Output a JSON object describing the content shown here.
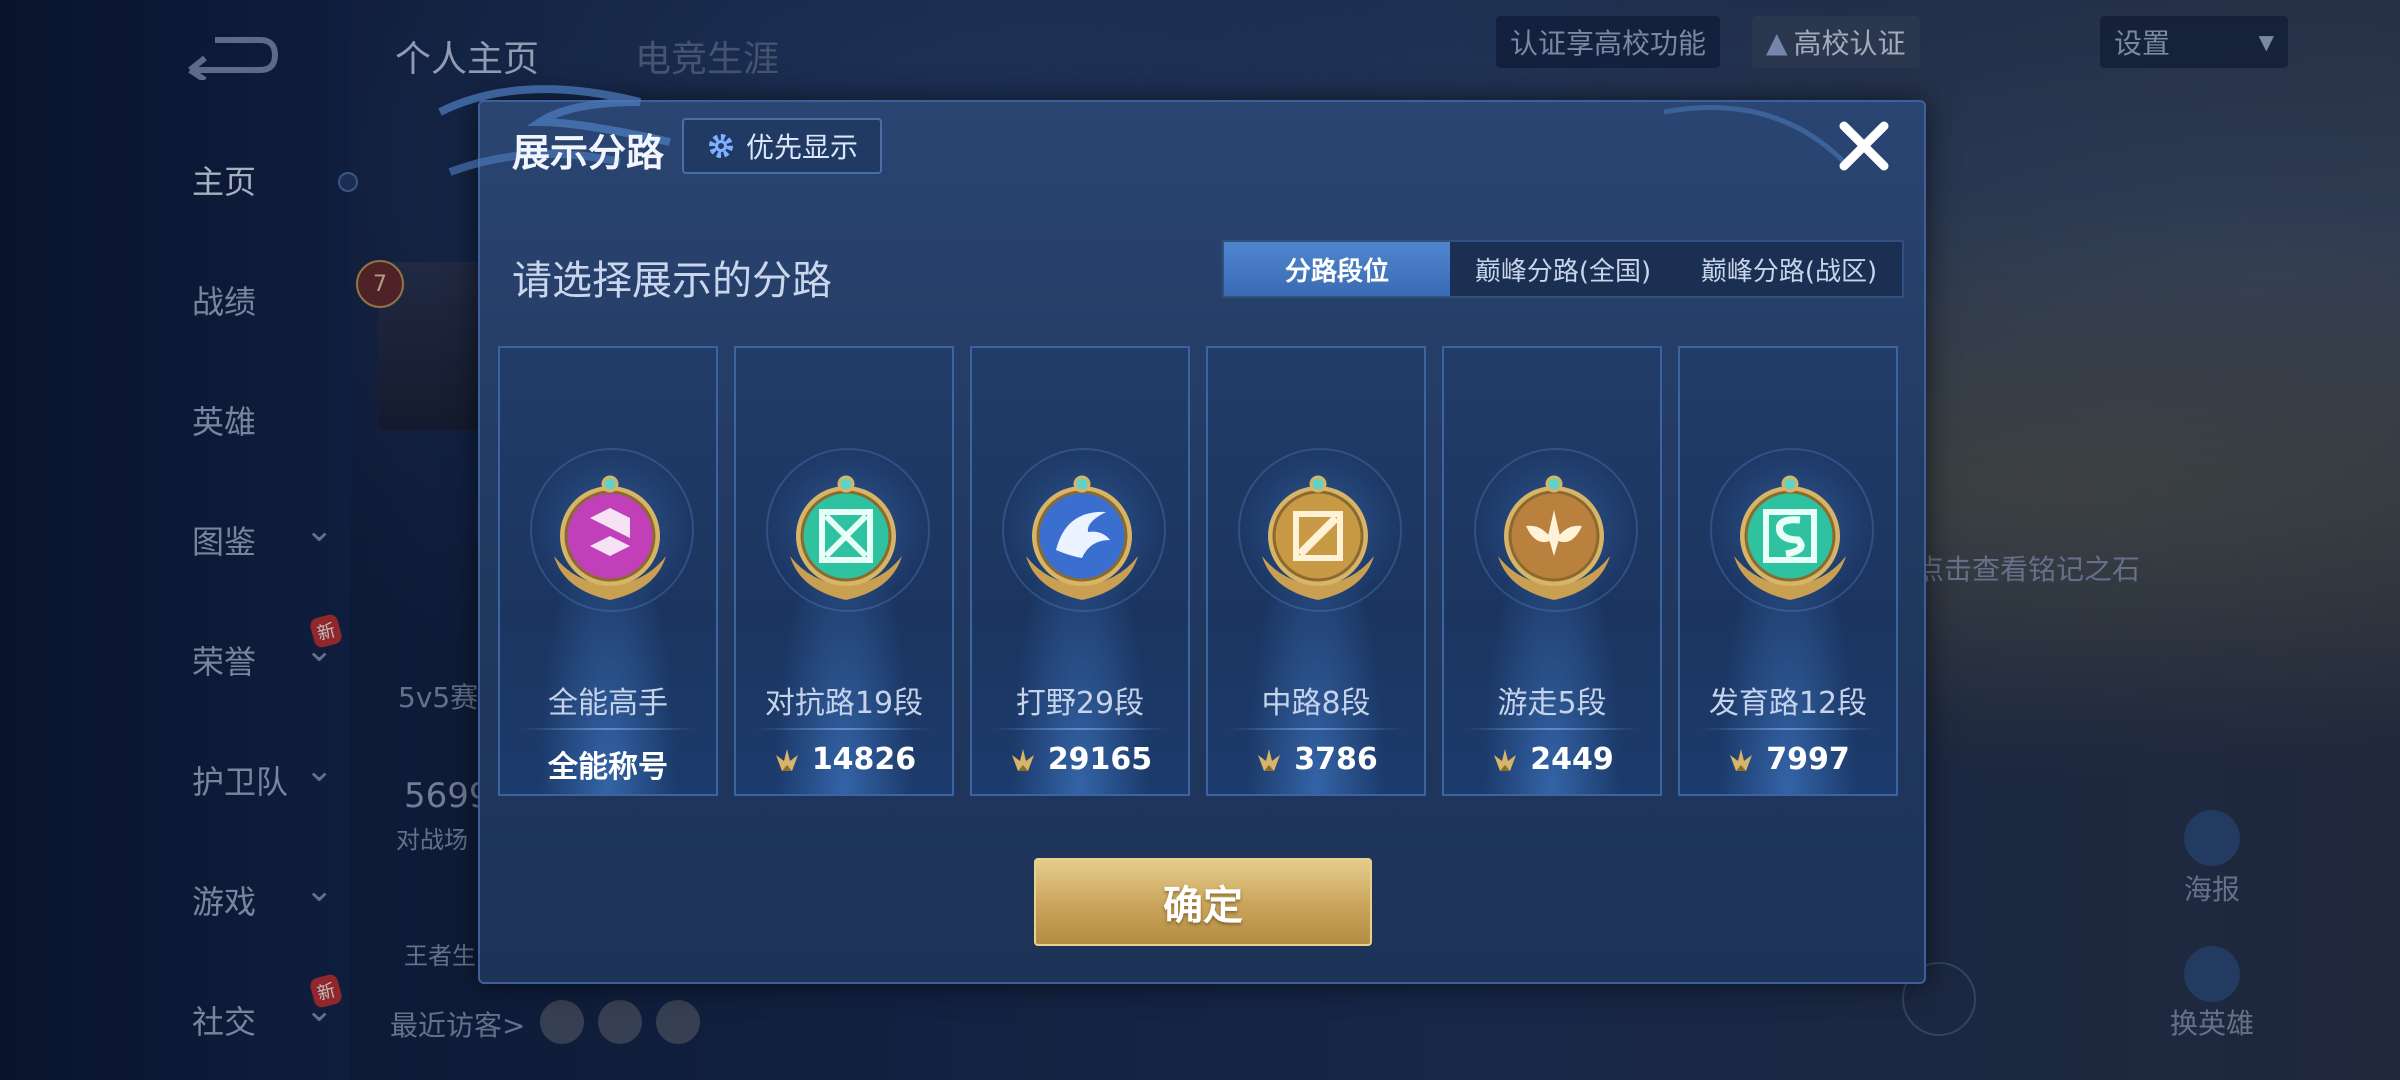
{
  "sidebar": {
    "items": [
      {
        "label": "主页",
        "active": true,
        "chevron": false,
        "new": false
      },
      {
        "label": "战绩",
        "active": false,
        "chevron": false,
        "new": false
      },
      {
        "label": "英雄",
        "active": false,
        "chevron": false,
        "new": false
      },
      {
        "label": "图鉴",
        "active": false,
        "chevron": true,
        "new": false
      },
      {
        "label": "荣誉",
        "active": false,
        "chevron": true,
        "new": true
      },
      {
        "label": "护卫队",
        "active": false,
        "chevron": true,
        "new": false
      },
      {
        "label": "游戏",
        "active": false,
        "chevron": true,
        "new": false
      },
      {
        "label": "社交",
        "active": false,
        "chevron": true,
        "new": true
      }
    ],
    "new_label": "新"
  },
  "header": {
    "tabs": [
      "个人主页",
      "电竞生涯"
    ],
    "campus_text": "认证享高校功能",
    "campus_button": "高校认证",
    "settings": "设置"
  },
  "background": {
    "level": "7",
    "match_label": "5v5赛",
    "big_number": "5699",
    "battle_label": "对战场",
    "king_label": "王者生",
    "recent_visitors": "最近访客>",
    "inscription_hint": "点击查看铭记之石",
    "poster_label": "海报",
    "change_hero_label": "换英雄",
    "new_label": "新"
  },
  "modal": {
    "title": "展示分路",
    "priority_button": "优先显示",
    "subtitle": "请选择展示的分路",
    "tabs": [
      {
        "label": "分路段位",
        "active": true
      },
      {
        "label": "巅峰分路(全国)",
        "active": false
      },
      {
        "label": "巅峰分路(战区)",
        "active": false
      }
    ],
    "cards": [
      {
        "name": "全能高手",
        "score": "全能称号",
        "icon": "all-round-emblem",
        "color": "#c13fb8",
        "show_points_icon": false
      },
      {
        "name": "对抗路19段",
        "score": "14826",
        "icon": "clash-lane-emblem",
        "color": "#2fc2a0",
        "show_points_icon": true
      },
      {
        "name": "打野29段",
        "score": "29165",
        "icon": "jungle-emblem",
        "color": "#3a6fd0",
        "show_points_icon": true
      },
      {
        "name": "中路8段",
        "score": "3786",
        "icon": "mid-lane-emblem",
        "color": "#c89a45",
        "show_points_icon": true
      },
      {
        "name": "游走5段",
        "score": "2449",
        "icon": "roam-emblem",
        "color": "#b9803e",
        "show_points_icon": true
      },
      {
        "name": "发育路12段",
        "score": "7997",
        "icon": "farm-lane-emblem",
        "color": "#2fc2a0",
        "show_points_icon": true
      }
    ],
    "confirm": "确定"
  },
  "colors": {
    "gold": "#d7b46a",
    "accent_blue": "#4f86cf",
    "modal_bg": "#23395f"
  }
}
